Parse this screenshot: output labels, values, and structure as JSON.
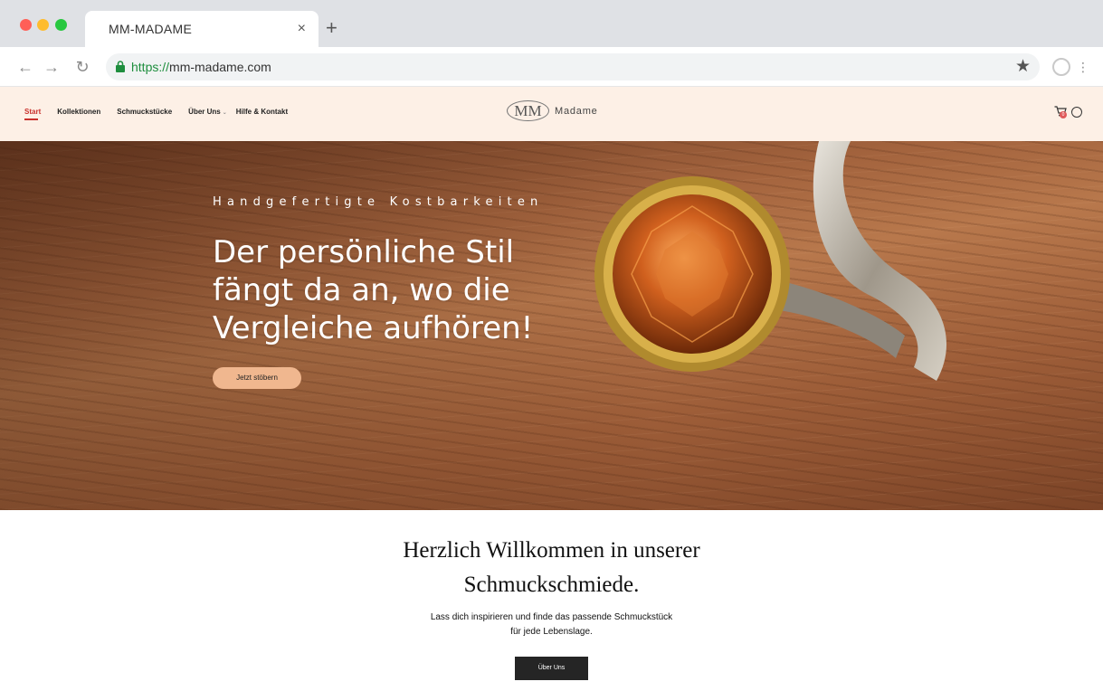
{
  "browser": {
    "tab_title": "MM-MADAME",
    "tab_close": "×",
    "new_tab": "+",
    "url_scheme": "https://",
    "url_host": "mm-madame.com"
  },
  "header": {
    "nav": [
      {
        "label": "Start",
        "active": true
      },
      {
        "label": "Kollektionen"
      },
      {
        "label": "Schmuckstücke"
      },
      {
        "label": "Über Uns",
        "has_dropdown": true
      },
      {
        "label": "Hilfe & Kontakt"
      }
    ],
    "logo_mark": "MM",
    "logo_text": "Madame",
    "cart_count": "0"
  },
  "hero": {
    "kicker": "Handgefertigte Kostbarkeiten",
    "title": "Der persönliche Stil fängt da an, wo die Vergleiche aufhören!",
    "button": "Jetzt stöbern"
  },
  "welcome": {
    "title_line1": "Herzlich Willkommen in unserer",
    "title_line2": "Schmuckschmiede.",
    "text_line1": "Lass dich inspirieren und finde das passende Schmuckstück",
    "text_line2": "für jede Lebenslage.",
    "button": "Über Uns"
  },
  "colors": {
    "header_bg": "#fdf0e6",
    "accent_red": "#c8302c",
    "hero_button": "#f0b78f",
    "dark_button": "#252525"
  },
  "icons": [
    "back-icon",
    "forward-icon",
    "reload-icon",
    "lock-icon",
    "star-icon",
    "profile-icon",
    "menu-icon",
    "cart-icon",
    "user-icon"
  ]
}
